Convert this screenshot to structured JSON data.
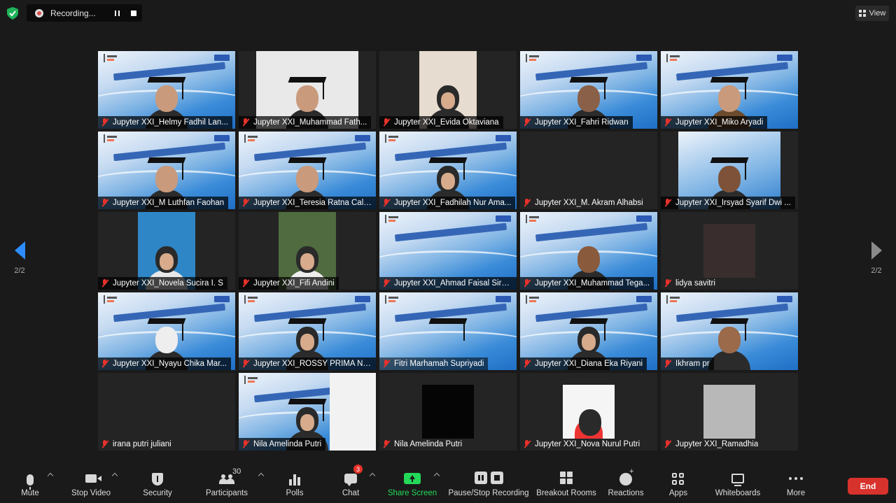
{
  "recording": {
    "status_label": "Recording...",
    "pause_icon": "pause-icon",
    "stop_icon": "stop-icon"
  },
  "view_label": "View",
  "pagination": {
    "left": "2/2",
    "right": "2/2"
  },
  "participants": [
    {
      "name": "Jupyter XXI_Helmy Fadhil Lan...",
      "muted": true
    },
    {
      "name": "Jupyter XXI_Muhammad Fath...",
      "muted": true
    },
    {
      "name": "Jupyter XXI_Evida Oktaviana",
      "muted": true
    },
    {
      "name": "Jupyter XXI_Fahri Ridwan",
      "muted": true
    },
    {
      "name": "Jupyter XXI_Miko Aryadi",
      "muted": true
    },
    {
      "name": "Jupyter XXI_M Luthfan Faohan",
      "muted": true
    },
    {
      "name": "Jupyter XXI_Teresia Ratna Cali...",
      "muted": true
    },
    {
      "name": "Jupyter XXI_Fadhilah Nur Ama...",
      "muted": true
    },
    {
      "name": "Jupyter XXI_M. Akram Alhabsi",
      "muted": true
    },
    {
      "name": "Jupyter XXI_Irsyad Syarif Dwi ...",
      "muted": true
    },
    {
      "name": "Jupyter XXI_Novela Sucira I. S",
      "muted": true
    },
    {
      "name": "Jupyter XXI_Fifi Andini",
      "muted": true
    },
    {
      "name": "Jupyter XXI_Ahmad Faisal Sire...",
      "muted": true
    },
    {
      "name": "Jupyter XXI_Muhammad Tega...",
      "muted": true
    },
    {
      "name": "lidya savitri",
      "muted": true
    },
    {
      "name": "Jupyter XXI_Nyayu Chika Mar...",
      "muted": true
    },
    {
      "name": "Jupyter XXI_ROSSY PRIMA NA...",
      "muted": true
    },
    {
      "name": "Fitri Marhamah Supriyadi",
      "muted": true
    },
    {
      "name": "Jupyter XXI_Diana Eka Riyani",
      "muted": true
    },
    {
      "name": "Ikhram pr",
      "muted": true
    },
    {
      "name": "irana putri juliani",
      "muted": true
    },
    {
      "name": "Nila Amelinda Putri",
      "muted": true
    },
    {
      "name": "Nila Amelinda Putri",
      "muted": true
    },
    {
      "name": "Jupyter XXI_Nova Nurul Putri",
      "muted": true
    },
    {
      "name": "Jupyter XXI_Ramadhia",
      "muted": true
    }
  ],
  "toolbar": {
    "mute": "Mute",
    "stop_video": "Stop Video",
    "security": "Security",
    "participants": "Participants",
    "participants_count": "30",
    "polls": "Polls",
    "chat": "Chat",
    "chat_badge": "3",
    "share_screen": "Share Screen",
    "pause_stop_recording": "Pause/Stop Recording",
    "breakout_rooms": "Breakout Rooms",
    "reactions": "Reactions",
    "apps": "Apps",
    "whiteboards": "Whiteboards",
    "more": "More",
    "end": "End"
  },
  "colors": {
    "background": "#1a1a1a",
    "accent_blue": "#2d8cff",
    "share_green": "#23d959",
    "end_red": "#d8322c",
    "mute_red": "#e8322b"
  }
}
